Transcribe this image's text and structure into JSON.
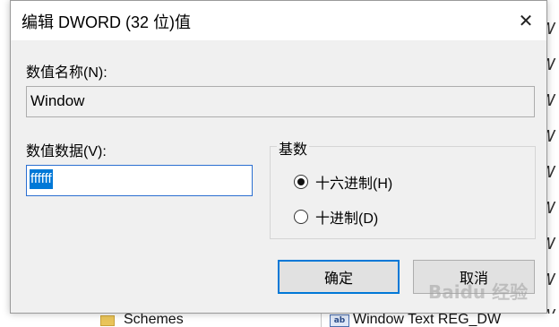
{
  "dialog": {
    "title": "编辑 DWORD (32 位)值",
    "close_symbol": "✕",
    "value_name_label": "数值名称(N):",
    "value_name": "Window",
    "value_data_label": "数值数据(V):",
    "value_data": "ffffff",
    "base_group_label": "基数",
    "base_options": [
      {
        "label": "十六进制(H)",
        "selected": true
      },
      {
        "label": "十进制(D)",
        "selected": false
      }
    ],
    "ok_label": "确定",
    "cancel_label": "取消"
  },
  "background": {
    "tree_item": "Schemes",
    "reg_icon_text": "ab",
    "reg_entry": "Window Text    REG_DW",
    "right_glyph": "W"
  },
  "watermark": {
    "text": "Baidu 经验"
  },
  "colors": {
    "accent": "#0078d7",
    "dialog_bg": "#f0f0f0",
    "titlebar_bg": "#ffffff"
  }
}
